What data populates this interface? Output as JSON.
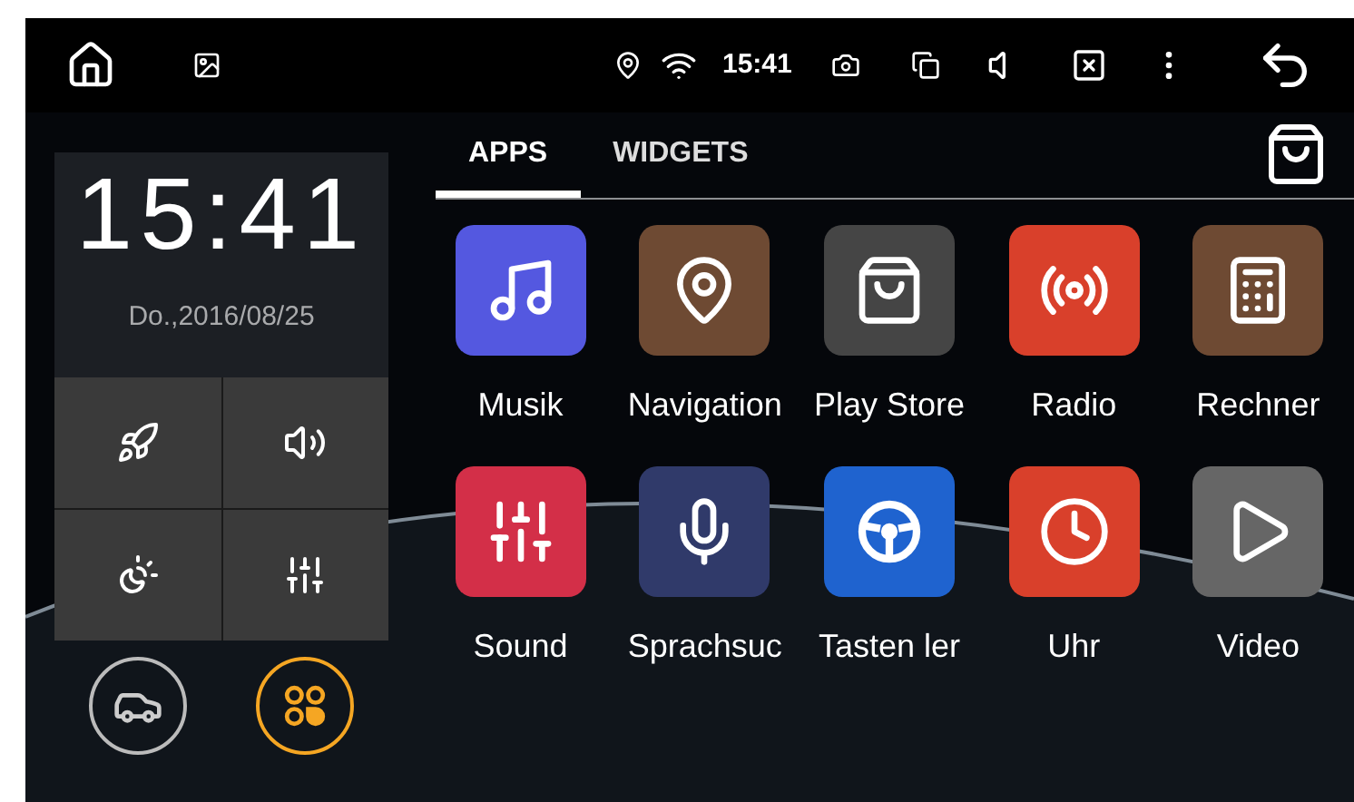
{
  "status_bar": {
    "time": "15:41"
  },
  "clock_widget": {
    "time": "15:41",
    "date": "Do.,2016/08/25"
  },
  "quick_settings": [
    {
      "kind": "rocket"
    },
    {
      "kind": "volume"
    },
    {
      "kind": "brightness"
    },
    {
      "kind": "equalizer"
    }
  ],
  "dock": [
    {
      "kind": "car",
      "selected": false
    },
    {
      "kind": "apps",
      "selected": true
    }
  ],
  "tabs": [
    {
      "label": "APPS",
      "selected": true
    },
    {
      "label": "WIDGETS",
      "selected": false
    }
  ],
  "apps": [
    {
      "label": "Musik",
      "kind": "music",
      "color": "#5458e0"
    },
    {
      "label": "Navigation",
      "kind": "pin",
      "color": "#6e4a33"
    },
    {
      "label": "Play Store",
      "kind": "store",
      "color": "#454545"
    },
    {
      "label": "Radio",
      "kind": "radio",
      "color": "#d9402b"
    },
    {
      "label": "Rechner",
      "kind": "calculator",
      "color": "#6e4a33"
    },
    {
      "label": "Sound",
      "kind": "sliders",
      "color": "#d32f48"
    },
    {
      "label": "Sprachsuc",
      "kind": "mic",
      "color": "#303a6a"
    },
    {
      "label": "Tasten ler",
      "kind": "wheel",
      "color": "#1f63cf"
    },
    {
      "label": "Uhr",
      "kind": "clock",
      "color": "#d9402b"
    },
    {
      "label": "Video",
      "kind": "video",
      "color": "#666666"
    }
  ]
}
